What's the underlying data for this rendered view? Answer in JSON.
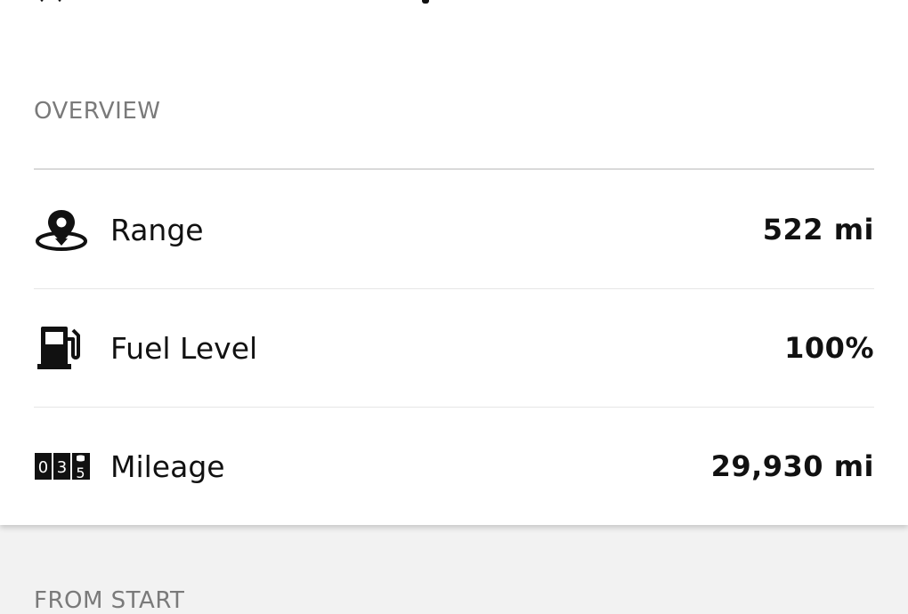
{
  "overview": {
    "section_title": "OVERVIEW",
    "items": [
      {
        "label": "Range",
        "value": "522 mi",
        "icon": "location-pin-icon"
      },
      {
        "label": "Fuel Level",
        "value": "100%",
        "icon": "fuel-pump-icon"
      },
      {
        "label": "Mileage",
        "value": "29,930 mi",
        "icon": "odometer-icon",
        "odometer_digits": [
          "0",
          "3",
          "5"
        ]
      }
    ]
  },
  "next_section": {
    "title": "FROM START"
  }
}
